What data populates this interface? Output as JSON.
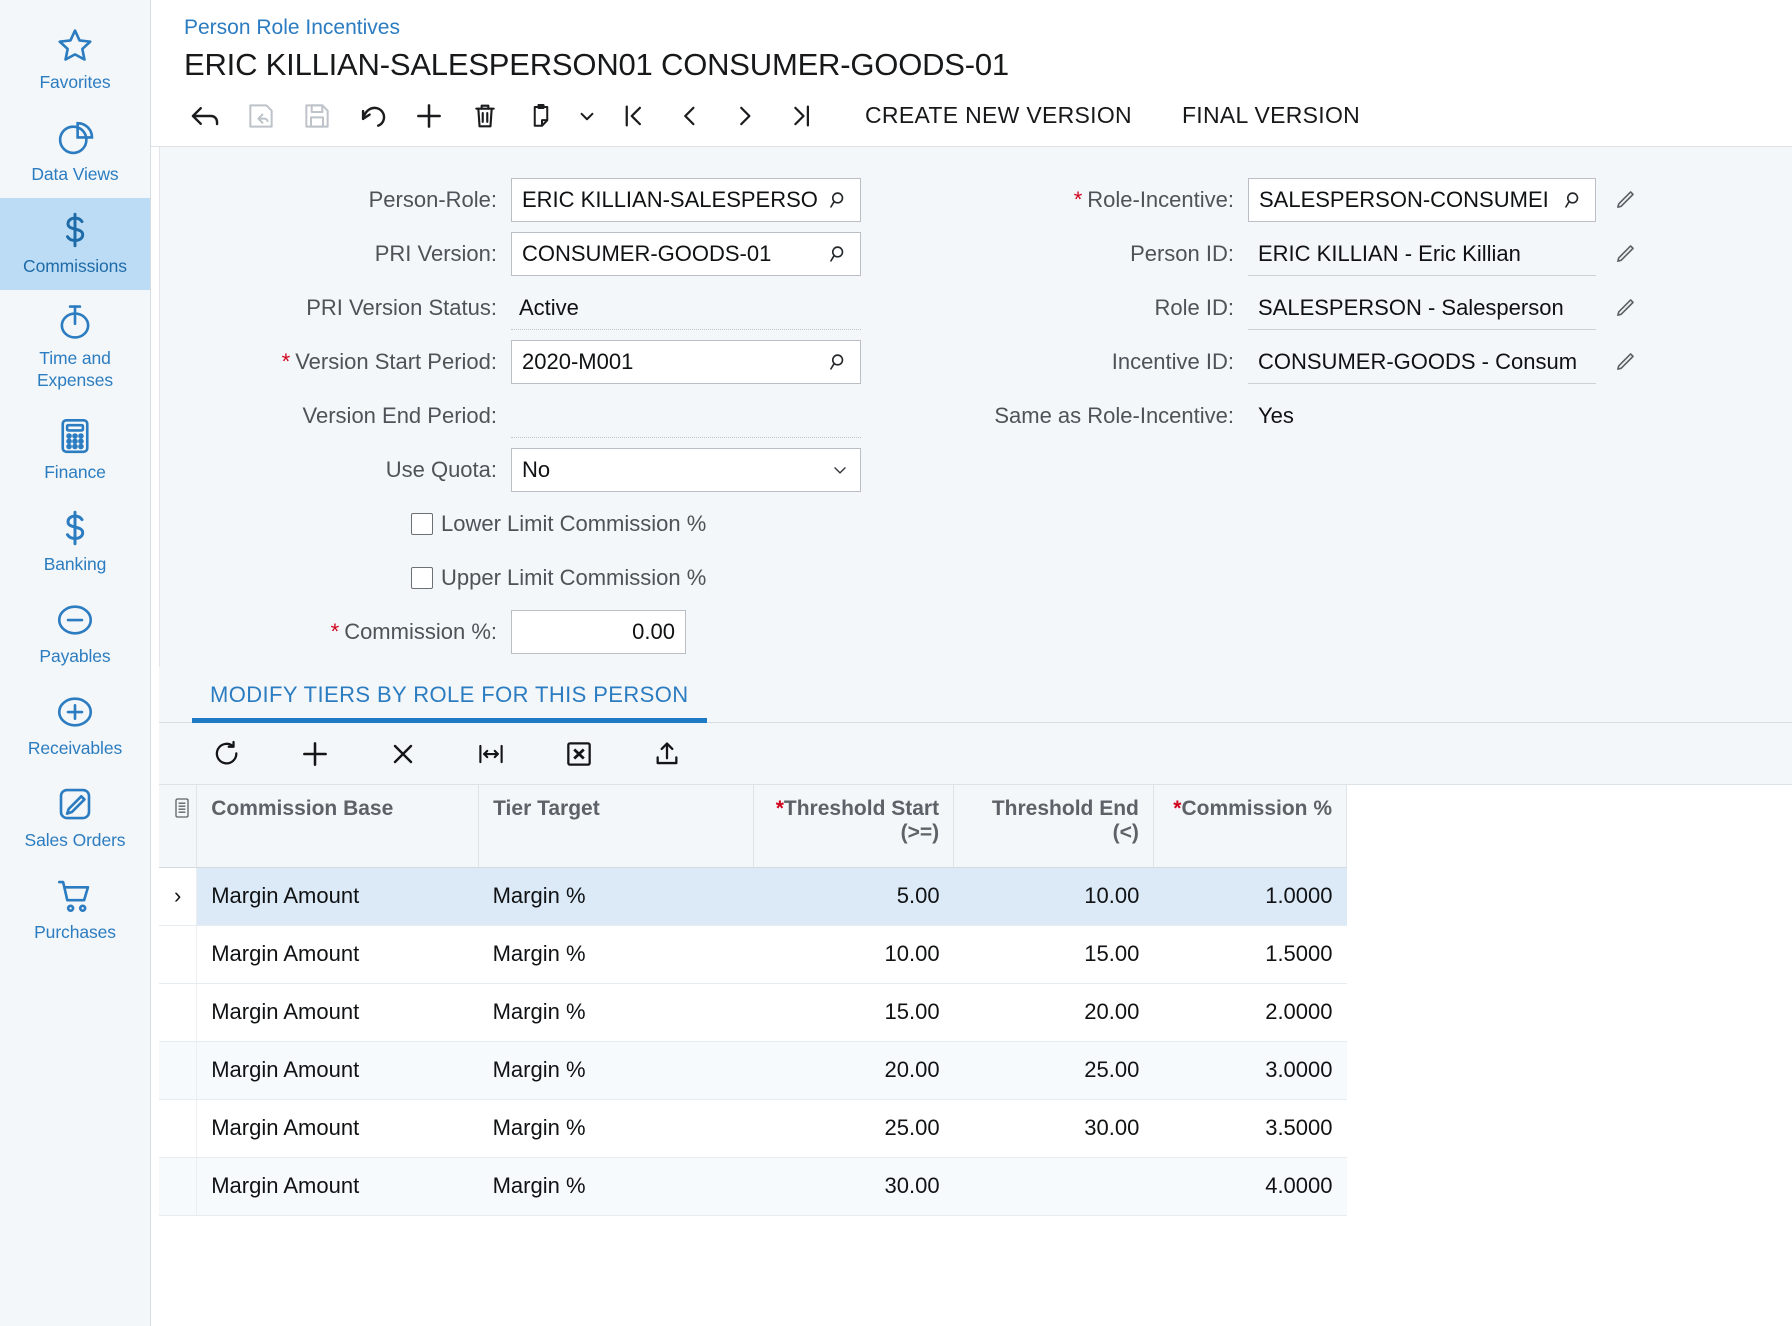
{
  "sidebar": {
    "items": [
      {
        "label": "Favorites",
        "icon": "star-icon",
        "active": false
      },
      {
        "label": "Data Views",
        "icon": "pie-chart-icon",
        "active": false
      },
      {
        "label": "Commissions",
        "icon": "dollar-icon",
        "active": true
      },
      {
        "label": "Time and Expenses",
        "icon": "stopwatch-icon",
        "active": false
      },
      {
        "label": "Finance",
        "icon": "calculator-icon",
        "active": false
      },
      {
        "label": "Banking",
        "icon": "dollar-icon",
        "active": false
      },
      {
        "label": "Payables",
        "icon": "minus-circle-icon",
        "active": false
      },
      {
        "label": "Receivables",
        "icon": "plus-circle-icon",
        "active": false
      },
      {
        "label": "Sales Orders",
        "icon": "pencil-square-icon",
        "active": false
      },
      {
        "label": "Purchases",
        "icon": "shopping-cart-icon",
        "active": false
      }
    ]
  },
  "header": {
    "breadcrumb": "Person Role Incentives",
    "title": "ERIC KILLIAN-SALESPERSON01 CONSUMER-GOODS-01"
  },
  "toolbar": {
    "icons": [
      {
        "name": "back-arrow-icon",
        "disabled": false
      },
      {
        "name": "save-and-back-icon",
        "disabled": true
      },
      {
        "name": "save-icon",
        "disabled": true
      },
      {
        "name": "undo-icon",
        "disabled": false
      },
      {
        "name": "add-icon",
        "disabled": false
      },
      {
        "name": "delete-trash-icon",
        "disabled": false
      },
      {
        "name": "clipboard-icon",
        "disabled": false
      },
      {
        "name": "chevron-down-icon",
        "disabled": false
      },
      {
        "name": "first-record-icon",
        "disabled": false
      },
      {
        "name": "previous-record-icon",
        "disabled": false
      },
      {
        "name": "next-record-icon",
        "disabled": false
      },
      {
        "name": "last-record-icon",
        "disabled": false
      }
    ],
    "create_new_version": "CREATE NEW VERSION",
    "final_version": "FINAL VERSION"
  },
  "form": {
    "left": {
      "person_role_label": "Person-Role:",
      "person_role_value": "ERIC KILLIAN-SALESPERSO",
      "pri_version_label": "PRI Version:",
      "pri_version_value": "CONSUMER-GOODS-01",
      "pri_version_status_label": "PRI Version Status:",
      "pri_version_status_value": "Active",
      "version_start_label": "Version Start Period:",
      "version_start_value": "2020-M001",
      "version_end_label": "Version End Period:",
      "version_end_value": "",
      "use_quota_label": "Use Quota:",
      "use_quota_value": "No",
      "lower_limit_label": "Lower Limit Commission %",
      "lower_limit_checked": false,
      "upper_limit_label": "Upper Limit Commission %",
      "upper_limit_checked": false,
      "commission_pct_label": "Commission %:",
      "commission_pct_value": "0.00"
    },
    "right": {
      "role_incentive_label": "Role-Incentive:",
      "role_incentive_value": "SALESPERSON-CONSUMEI",
      "person_id_label": "Person ID:",
      "person_id_value": "ERIC KILLIAN - Eric Killian",
      "role_id_label": "Role ID:",
      "role_id_value": "SALESPERSON - Salesperson",
      "incentive_id_label": "Incentive ID:",
      "incentive_id_value": "CONSUMER-GOODS - Consum",
      "same_as_role_incentive_label": "Same as Role-Incentive:",
      "same_as_role_incentive_value": "Yes"
    }
  },
  "tabs": [
    {
      "label": "MODIFY TIERS BY ROLE FOR THIS PERSON",
      "active": true
    }
  ],
  "grid_toolbar": {
    "icons": [
      {
        "name": "refresh-icon"
      },
      {
        "name": "add-row-icon"
      },
      {
        "name": "delete-row-icon"
      },
      {
        "name": "fit-columns-icon"
      },
      {
        "name": "export-excel-icon"
      },
      {
        "name": "upload-icon"
      }
    ]
  },
  "table": {
    "columns": [
      {
        "key": "sel",
        "label": "",
        "required": false,
        "align": "center"
      },
      {
        "key": "base",
        "label": "Commission Base",
        "required": false,
        "align": "left"
      },
      {
        "key": "tier",
        "label": "Tier Target",
        "required": false,
        "align": "left"
      },
      {
        "key": "tstart",
        "label": "Threshold Start (>=)",
        "required": true,
        "align": "right"
      },
      {
        "key": "tend",
        "label": "Threshold End (<)",
        "required": false,
        "align": "right"
      },
      {
        "key": "comm",
        "label": "Commission %",
        "required": true,
        "align": "right"
      }
    ],
    "rows": [
      {
        "selected": true,
        "base": "Margin Amount",
        "tier": "Margin %",
        "tstart": "5.00",
        "tend": "10.00",
        "comm": "1.0000",
        "marker": "›"
      },
      {
        "selected": false,
        "base": "Margin Amount",
        "tier": "Margin %",
        "tstart": "10.00",
        "tend": "15.00",
        "comm": "1.5000",
        "marker": ""
      },
      {
        "selected": false,
        "base": "Margin Amount",
        "tier": "Margin %",
        "tstart": "15.00",
        "tend": "20.00",
        "comm": "2.0000",
        "marker": ""
      },
      {
        "selected": false,
        "base": "Margin Amount",
        "tier": "Margin %",
        "tstart": "20.00",
        "tend": "25.00",
        "comm": "3.0000",
        "marker": ""
      },
      {
        "selected": false,
        "base": "Margin Amount",
        "tier": "Margin %",
        "tstart": "25.00",
        "tend": "30.00",
        "comm": "3.5000",
        "marker": ""
      },
      {
        "selected": false,
        "base": "Margin Amount",
        "tier": "Margin %",
        "tstart": "30.00",
        "tend": "",
        "comm": "4.0000",
        "marker": ""
      }
    ]
  },
  "colors": {
    "accent_blue": "#2b7cc0",
    "sidebar_active": "#bcdcf5",
    "panel_bg": "#f4f7f9",
    "required_red": "#d0021b",
    "row_selected": "#dceaf7"
  }
}
